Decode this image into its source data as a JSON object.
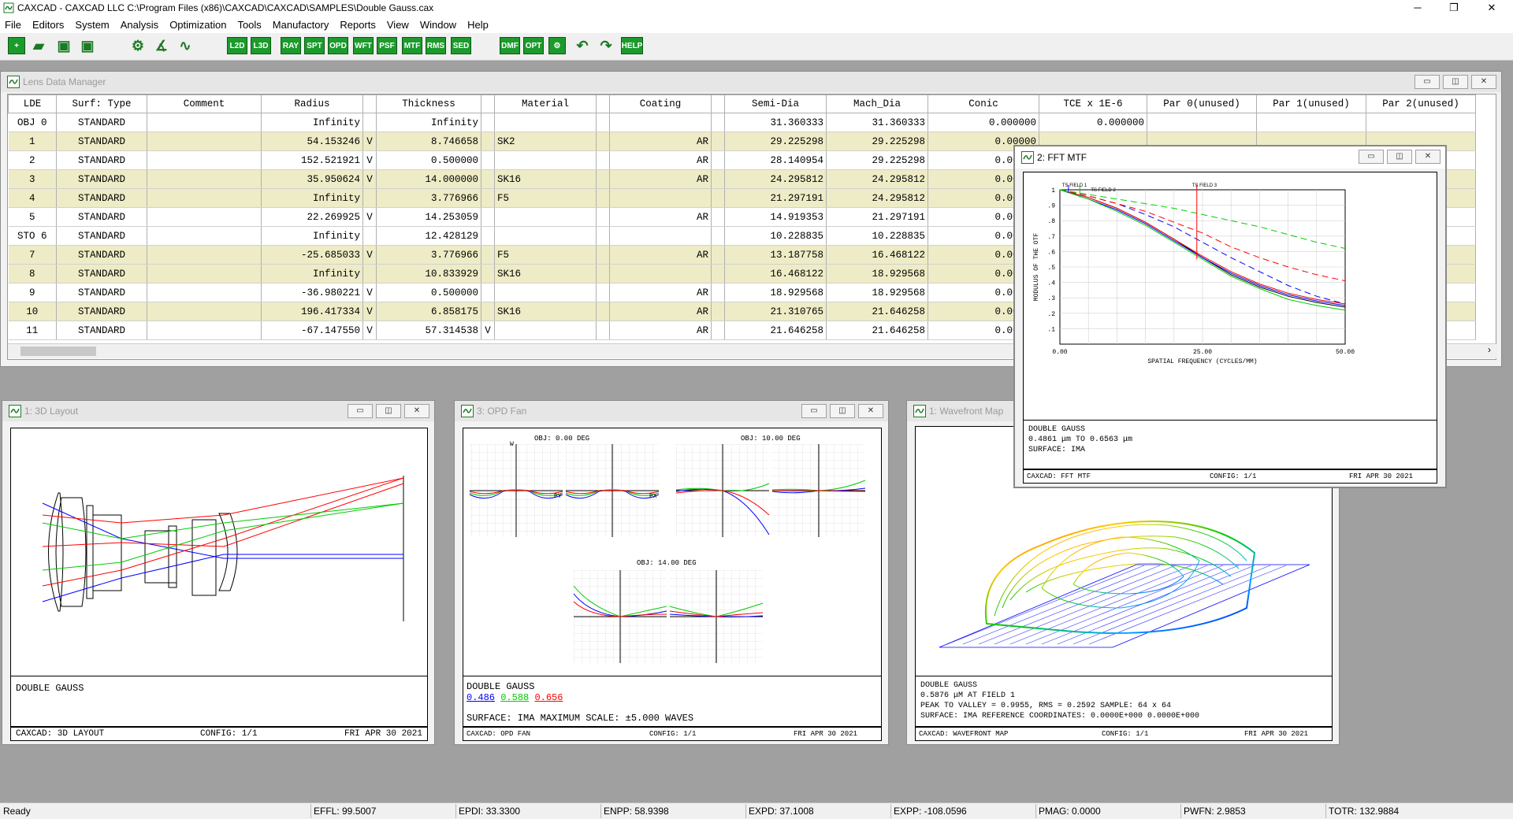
{
  "window": {
    "title": "CAXCAD - CAXCAD LLC C:\\Program Files (x86)\\CAXCAD\\CAXCAD\\SAMPLES\\Double Gauss.cax",
    "minimize": "─",
    "maximize": "❐",
    "close": "✕"
  },
  "menu": [
    "File",
    "Editors",
    "System",
    "Analysis",
    "Optimization",
    "Tools",
    "Manufactory",
    "Reports",
    "View",
    "Window",
    "Help"
  ],
  "toolbar": {
    "buttons": [
      "L2D",
      "L3D",
      "RAY",
      "SPT",
      "OPD",
      "WFT",
      "PSF",
      "MTF",
      "RMS",
      "SED",
      "DMF",
      "OPT",
      "HELP"
    ]
  },
  "lde": {
    "title": "Lens Data Manager",
    "columns": [
      "LDE",
      "Surf: Type",
      "Comment",
      "Radius",
      "",
      "Thickness",
      "",
      "Material",
      "",
      "Coating",
      "",
      "Semi-Dia",
      "Mach_Dia",
      "Conic",
      "TCE x 1E-6",
      "Par 0(unused)",
      "Par 1(unused)",
      "Par 2(unused)"
    ],
    "rows": [
      [
        "OBJ 0",
        "STANDARD",
        "",
        "Infinity",
        "",
        "Infinity",
        "",
        "",
        "",
        "",
        "",
        "31.360333",
        "31.360333",
        "0.000000",
        "0.000000",
        "",
        "",
        ""
      ],
      [
        "1",
        "STANDARD",
        "",
        "54.153246",
        "V",
        "8.746658",
        "",
        "SK2",
        "",
        "AR",
        "",
        "29.225298",
        "29.225298",
        "0.00000",
        "",
        "",
        "",
        ""
      ],
      [
        "2",
        "STANDARD",
        "",
        "152.521921",
        "V",
        "0.500000",
        "",
        "",
        "",
        "AR",
        "",
        "28.140954",
        "29.225298",
        "0.00000",
        "",
        "",
        "",
        ""
      ],
      [
        "3",
        "STANDARD",
        "",
        "35.950624",
        "V",
        "14.000000",
        "",
        "SK16",
        "",
        "AR",
        "",
        "24.295812",
        "24.295812",
        "0.00000",
        "",
        "",
        "",
        ""
      ],
      [
        "4",
        "STANDARD",
        "",
        "Infinity",
        "",
        "3.776966",
        "",
        "F5",
        "",
        "",
        "",
        "21.297191",
        "24.295812",
        "0.00000",
        "",
        "",
        "",
        ""
      ],
      [
        "5",
        "STANDARD",
        "",
        "22.269925",
        "V",
        "14.253059",
        "",
        "",
        "",
        "AR",
        "",
        "14.919353",
        "21.297191",
        "0.00000",
        "",
        "",
        "",
        ""
      ],
      [
        "STO 6",
        "STANDARD",
        "",
        "Infinity",
        "",
        "12.428129",
        "",
        "",
        "",
        "",
        "",
        "10.228835",
        "10.228835",
        "0.00000",
        "",
        "",
        "",
        ""
      ],
      [
        "7",
        "STANDARD",
        "",
        "-25.685033",
        "V",
        "3.776966",
        "",
        "F5",
        "",
        "AR",
        "",
        "13.187758",
        "16.468122",
        "0.00000",
        "",
        "",
        "",
        ""
      ],
      [
        "8",
        "STANDARD",
        "",
        "Infinity",
        "",
        "10.833929",
        "",
        "SK16",
        "",
        "",
        "",
        "16.468122",
        "18.929568",
        "0.00000",
        "",
        "",
        "",
        ""
      ],
      [
        "9",
        "STANDARD",
        "",
        "-36.980221",
        "V",
        "0.500000",
        "",
        "",
        "",
        "AR",
        "",
        "18.929568",
        "18.929568",
        "0.00000",
        "",
        "",
        "",
        ""
      ],
      [
        "10",
        "STANDARD",
        "",
        "196.417334",
        "V",
        "6.858175",
        "",
        "SK16",
        "",
        "AR",
        "",
        "21.310765",
        "21.646258",
        "0.00000",
        "",
        "",
        "",
        ""
      ],
      [
        "11",
        "STANDARD",
        "",
        "-67.147550",
        "V",
        "57.314538",
        "V",
        "",
        "",
        "AR",
        "",
        "21.646258",
        "21.646258",
        "0.00000",
        "",
        "",
        "",
        ""
      ]
    ]
  },
  "layout3d": {
    "title": "1: 3D Layout",
    "name": "DOUBLE GAUSS",
    "footer_left": "CAXCAD: 3D LAYOUT",
    "footer_mid": "CONFIG: 1/1",
    "footer_right": "FRI APR 30 2021"
  },
  "opdfan": {
    "title": "3: OPD Fan",
    "obj0": "OBJ: 0.00 DEG",
    "obj1": "OBJ: 10.00 DEG",
    "obj2": "OBJ: 14.00 DEG",
    "axis_w": "W",
    "axis_py": "PY",
    "axis_px": "PX",
    "name": "DOUBLE GAUSS",
    "wl1": "0.486",
    "wl2": "0.588",
    "wl3": "0.656",
    "surface": "SURFACE: IMA  MAXIMUM SCALE: ±5.000 WAVES",
    "footer_left": "CAXCAD: OPD FAN",
    "footer_mid": "CONFIG: 1/1",
    "footer_right": "FRI APR 30 2021",
    "colors": {
      "blue": "#0000ff",
      "green": "#00cc00",
      "red": "#ff0000"
    }
  },
  "wavefront": {
    "title": "1: Wavefront Map",
    "name": "DOUBLE GAUSS",
    "line1": "0.5876 μM AT FIELD 1",
    "line2": "PEAK TO VALLEY = 0.9955, RMS = 0.2592     SAMPLE: 64 x 64",
    "line3": "SURFACE: IMA     REFERENCE COORDINATES: 0.0000E+000  0.0000E+000",
    "footer_left": "CAXCAD: WAVEFRONT MAP",
    "footer_mid": "CONFIG: 1/1",
    "footer_right": "FRI APR 30 2021"
  },
  "mtf": {
    "title": "2: FFT MTF",
    "name": "DOUBLE GAUSS",
    "line1": "0.4861 μm TO 0.6563 μm",
    "line2": "SURFACE: IMA",
    "footer_left": "CAXCAD: FFT MTF",
    "footer_mid": "CONFIG: 1/1",
    "footer_right": "FRI APR 30 2021"
  },
  "chart_data": {
    "type": "line",
    "xlabel": "SPATIAL FREQUENCY (CYCLES/MM)",
    "ylabel": "MODULUS OF THE OTF",
    "xlim": [
      0,
      50
    ],
    "ylim": [
      0,
      1
    ],
    "x_ticks": [
      "0.00",
      "25.00",
      "50.00"
    ],
    "y_ticks": [
      "1",
      ".9",
      ".8",
      ".7",
      ".6",
      ".5",
      ".4",
      ".3",
      ".2",
      ".1"
    ],
    "annotations": [
      "TS FIELD 1",
      "TS FIELD 2",
      "TS FIELD 3"
    ],
    "grid": true,
    "series": [
      {
        "color": "#000000",
        "style": "solid",
        "x": [
          0,
          5,
          10,
          15,
          20,
          25,
          30,
          35,
          40,
          45,
          50
        ],
        "values": [
          1.0,
          0.95,
          0.88,
          0.79,
          0.68,
          0.56,
          0.45,
          0.37,
          0.31,
          0.27,
          0.24
        ]
      },
      {
        "color": "#0000ff",
        "style": "dashed",
        "x": [
          0,
          5,
          10,
          15,
          20,
          25,
          30,
          35,
          40,
          45,
          50
        ],
        "values": [
          1.0,
          0.96,
          0.91,
          0.84,
          0.76,
          0.66,
          0.56,
          0.47,
          0.38,
          0.31,
          0.26
        ]
      },
      {
        "color": "#0000ff",
        "style": "solid",
        "x": [
          0,
          5,
          10,
          15,
          20,
          25,
          30,
          35,
          40,
          45,
          50
        ],
        "values": [
          1.0,
          0.94,
          0.87,
          0.78,
          0.67,
          0.56,
          0.46,
          0.38,
          0.32,
          0.28,
          0.25
        ]
      },
      {
        "color": "#ff0000",
        "style": "dashed",
        "x": [
          0,
          5,
          10,
          15,
          20,
          25,
          30,
          35,
          40,
          45,
          50
        ],
        "values": [
          1.0,
          0.96,
          0.91,
          0.86,
          0.79,
          0.72,
          0.63,
          0.56,
          0.5,
          0.45,
          0.41
        ]
      },
      {
        "color": "#ff0000",
        "style": "solid",
        "x": [
          0,
          5,
          10,
          15,
          20,
          25,
          30,
          35,
          40,
          45,
          50
        ],
        "values": [
          1.0,
          0.95,
          0.88,
          0.79,
          0.68,
          0.57,
          0.47,
          0.39,
          0.33,
          0.29,
          0.26
        ]
      },
      {
        "color": "#00cc00",
        "style": "dashed",
        "x": [
          0,
          5,
          10,
          15,
          20,
          25,
          30,
          35,
          40,
          45,
          50
        ],
        "values": [
          1.0,
          0.97,
          0.94,
          0.91,
          0.88,
          0.84,
          0.8,
          0.76,
          0.71,
          0.66,
          0.62
        ]
      },
      {
        "color": "#00cc00",
        "style": "solid",
        "x": [
          0,
          5,
          10,
          15,
          20,
          25,
          30,
          35,
          40,
          45,
          50
        ],
        "values": [
          1.0,
          0.94,
          0.86,
          0.77,
          0.66,
          0.55,
          0.44,
          0.36,
          0.29,
          0.25,
          0.22
        ]
      }
    ]
  },
  "status": {
    "ready": "Ready",
    "effl": "EFFL: 99.5007",
    "epdi": "EPDI: 33.3300",
    "enpp": "ENPP: 58.9398",
    "expd": "EXPD: 37.1008",
    "expp": "EXPP: -108.0596",
    "pmag": "PMAG: 0.0000",
    "pwfn": "PWFN: 2.9853",
    "totr": "TOTR: 132.9884"
  }
}
